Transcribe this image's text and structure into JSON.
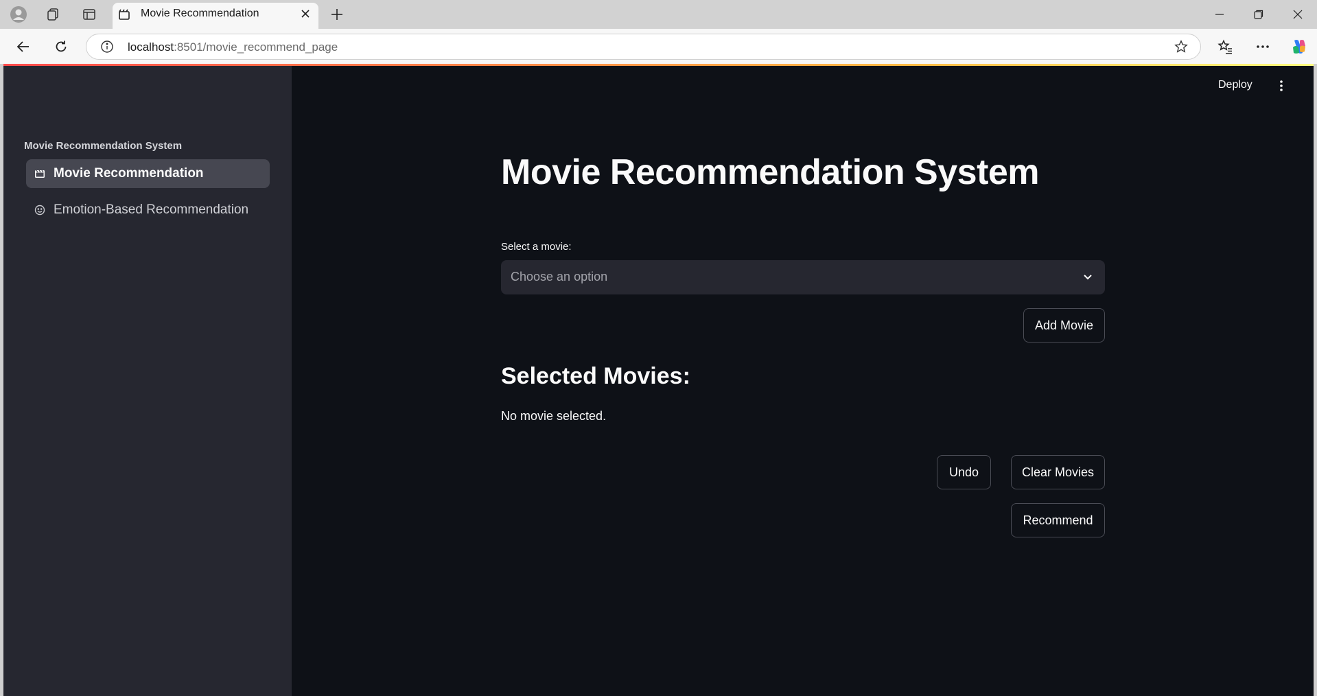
{
  "browser": {
    "tab_title": "Movie Recommendation",
    "url_host": "localhost",
    "url_rest": ":8501/movie_recommend_page"
  },
  "sidebar": {
    "heading": "Movie Recommendation System",
    "items": [
      {
        "label": "Movie Recommendation",
        "icon": "movie-icon",
        "active": true
      },
      {
        "label": "Emotion-Based Recommendation",
        "icon": "smiley-icon",
        "active": false
      }
    ]
  },
  "header": {
    "deploy_label": "Deploy"
  },
  "main": {
    "title": "Movie Recommendation System",
    "select_label": "Select a movie:",
    "select_placeholder": "Choose an option",
    "add_button": "Add Movie",
    "selected_heading": "Selected Movies:",
    "empty_message": "No movie selected.",
    "undo_button": "Undo",
    "clear_button": "Clear Movies",
    "recommend_button": "Recommend"
  },
  "colors": {
    "app_bg": "#0e1117",
    "sidebar_bg": "#262730",
    "active_item_bg": "#464751",
    "select_bg": "#262730",
    "accent_gradient_start": "#ff4b4b",
    "accent_gradient_end": "#fffd80"
  }
}
